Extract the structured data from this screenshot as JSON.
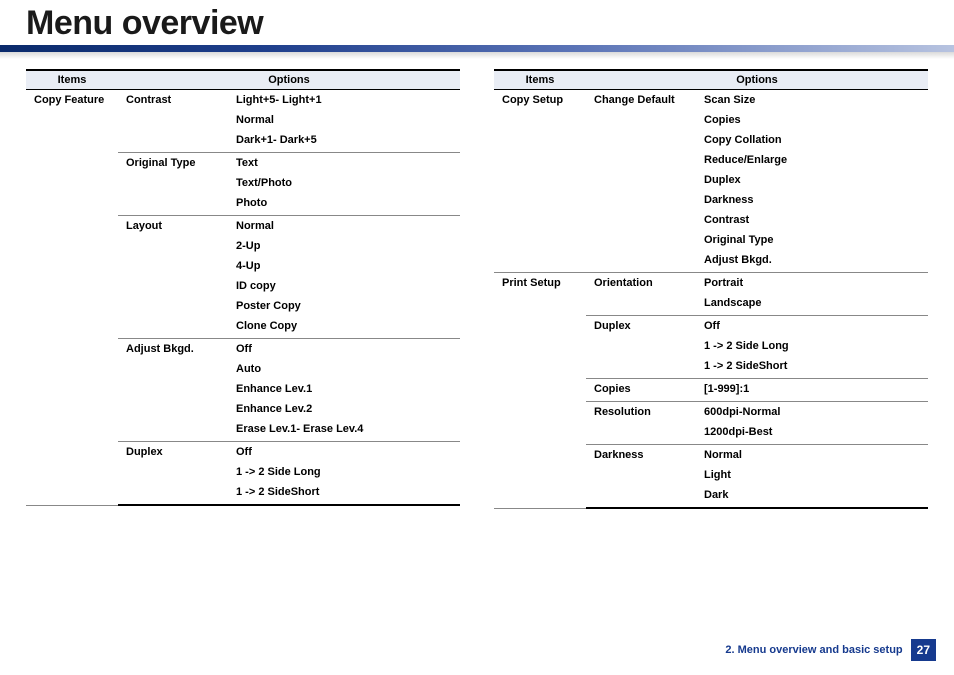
{
  "title": "Menu overview",
  "headers": {
    "items": "Items",
    "options": "Options"
  },
  "left_table": [
    {
      "item": "Copy Feature",
      "sub": "Contrast",
      "opts": [
        "Light+5- Light+1",
        "Normal",
        "Dark+1- Dark+5"
      ]
    },
    {
      "item": "",
      "sub": "Original Type",
      "opts": [
        "Text",
        "Text/Photo",
        "Photo"
      ]
    },
    {
      "item": "",
      "sub": "Layout",
      "opts": [
        "Normal",
        "2-Up",
        "4-Up",
        "ID copy",
        "Poster Copy",
        "Clone Copy"
      ]
    },
    {
      "item": "",
      "sub": "Adjust Bkgd.",
      "opts": [
        "Off",
        "Auto",
        "Enhance Lev.1",
        "Enhance Lev.2",
        "Erase Lev.1- Erase Lev.4"
      ]
    },
    {
      "item": "",
      "sub": "Duplex",
      "opts": [
        "Off",
        "1 -> 2 Side Long",
        "1 -> 2 SideShort"
      ]
    }
  ],
  "right_table": [
    {
      "item": "Copy Setup",
      "sub": "Change Default",
      "opts": [
        "Scan Size",
        "Copies",
        "Copy Collation",
        "Reduce/Enlarge",
        "Duplex",
        "Darkness",
        "Contrast",
        "Original Type",
        "Adjust Bkgd."
      ]
    },
    {
      "item": "Print Setup",
      "sub": "Orientation",
      "opts": [
        "Portrait",
        "Landscape"
      ]
    },
    {
      "item": "",
      "sub": "Duplex",
      "opts": [
        "Off",
        "1 -> 2 Side Long",
        "1 -> 2 SideShort"
      ]
    },
    {
      "item": "",
      "sub": "Copies",
      "opts": [
        "[1-999]:1"
      ]
    },
    {
      "item": "",
      "sub": "Resolution",
      "opts": [
        "600dpi-Normal",
        "1200dpi-Best"
      ]
    },
    {
      "item": "",
      "sub": "Darkness",
      "opts": [
        "Normal",
        "Light",
        "Dark"
      ]
    }
  ],
  "footer": {
    "chapter": "2. Menu overview and basic setup",
    "page": "27"
  }
}
